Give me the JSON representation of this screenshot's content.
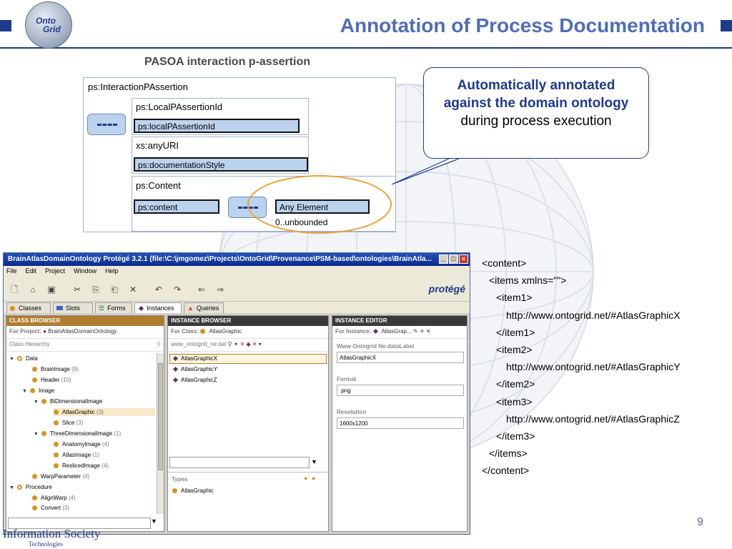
{
  "slide": {
    "title": "Annotation of Process Documentation",
    "subtitle": "PASOA interaction p-assertion",
    "page_number": "9",
    "logo_text_line1": "Onto",
    "logo_text_line2": "Grid",
    "footer_line1": "Information Society",
    "footer_line2": "Technologies",
    "accent_color": "#1f3a8a",
    "title_color": "#4f6eb6"
  },
  "schema": {
    "root_label": "ps:InteractionPAssertion",
    "boxes": [
      {
        "title": "ps:LocalPAssertionId",
        "field": "ps:localPAssertionId"
      },
      {
        "title": "xs:anyURI",
        "field": "ps:documentationStyle"
      },
      {
        "title": "ps:Content",
        "field": "ps:content"
      }
    ],
    "any_element": "Any Element",
    "multiplicity": "0..unbounded"
  },
  "callout": {
    "bold_text": "Automatically annotated against the domain ontology",
    "normal_text": " during process execution"
  },
  "protege": {
    "title": "BrainAtlasDomainOntology  Protégé 3.2.1     (file:\\C:\\jmgomez\\Projects\\OntoGrid\\Provenance\\PSM-based\\ontologies\\BrainAtla...",
    "menu": [
      "File",
      "Edit",
      "Project",
      "Window",
      "Help"
    ],
    "brand": "protégé",
    "tabs": [
      "Classes",
      "Slots",
      "Forms",
      "Instances",
      "Queries"
    ],
    "class_browser": {
      "header": "CLASS BROWSER",
      "for_project_label": "For Project:",
      "project": "BrainAtlasDomainOntology",
      "hierarchy_label": "Class Hierarchy",
      "items": [
        {
          "name": "Data",
          "count": ""
        },
        {
          "name": "BrainImage",
          "count": "(9)"
        },
        {
          "name": "Header",
          "count": "(10)"
        },
        {
          "name": "Image",
          "count": ""
        },
        {
          "name": "BiDimensionalImage",
          "count": ""
        },
        {
          "name": "AtlasGraphic",
          "count": "(3)"
        },
        {
          "name": "Slice",
          "count": "(3)"
        },
        {
          "name": "ThreeDimensionalImage",
          "count": "(1)"
        },
        {
          "name": "AnatomyImage",
          "count": "(4)"
        },
        {
          "name": "AtlasImage",
          "count": "(1)"
        },
        {
          "name": "ReslicedImage",
          "count": "(4)"
        },
        {
          "name": "WarpParameter",
          "count": "(4)"
        },
        {
          "name": "Procedure",
          "count": ""
        },
        {
          "name": "AlignWarp",
          "count": "(4)"
        },
        {
          "name": "Convert",
          "count": "(3)"
        }
      ]
    },
    "instance_browser": {
      "header": "INSTANCE BROWSER",
      "for_class_label": "For Class:",
      "class": "AtlasGraphic",
      "slot_label": "www_ontogrid_ne:dat",
      "instances": [
        "AtlasGraphicX",
        "AtlasGraphicY",
        "AtlasGraphicZ"
      ],
      "types_label": "Types",
      "types": [
        "AtlasGraphic"
      ]
    },
    "instance_editor": {
      "header": "INSTANCE EDITOR",
      "for_instance_label": "For Instance:",
      "instance": "AtlasGrap...",
      "fields": [
        {
          "label": "Www Ontogrid Ne:dataLabel",
          "value": "AtlasGraphicX"
        },
        {
          "label": "Format",
          "value": ".png"
        },
        {
          "label": "Resolution",
          "value": "1600x1200"
        }
      ]
    }
  },
  "xml_lines": [
    "<content>",
    "<items xmlns=\"\">",
    "<item1>",
    "http://www.ontogrid.net/#AtlasGraphicX",
    "</item1>",
    "<item2>",
    "http://www.ontogrid.net/#AtlasGraphicY",
    "</item2>",
    "<item3>",
    "http://www.ontogrid.net/#AtlasGraphicZ",
    "</item3>",
    "</items>",
    "</content>"
  ]
}
